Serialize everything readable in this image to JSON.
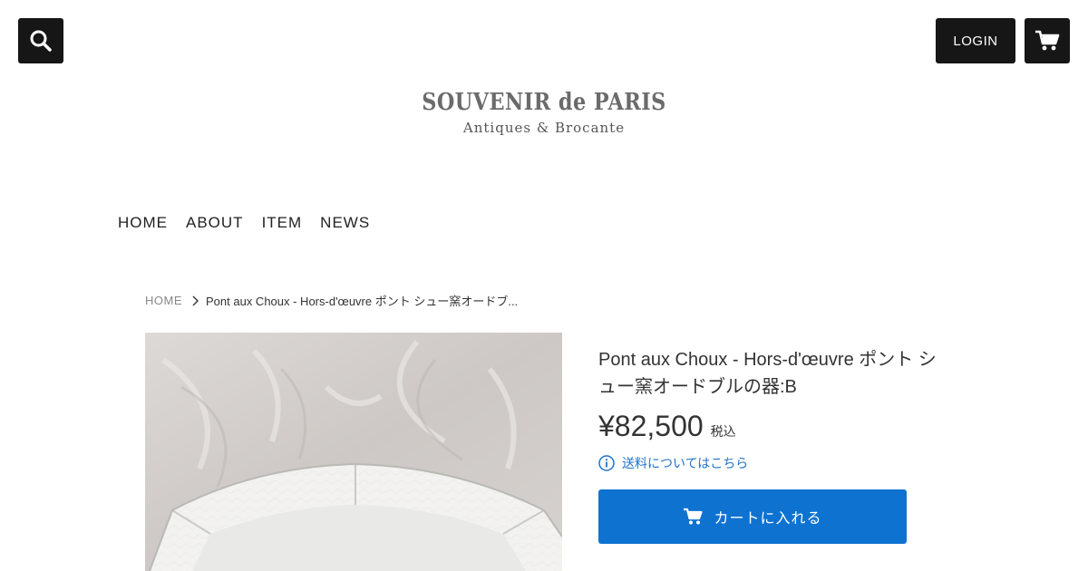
{
  "header": {
    "search_icon": "search-icon",
    "login_label": "LOGIN",
    "cart_icon": "cart-icon",
    "logo_title": "SOUVENIR de PARIS",
    "logo_subtitle": "Antiques & Brocante"
  },
  "nav": {
    "items": [
      {
        "label": "HOME"
      },
      {
        "label": "ABOUT"
      },
      {
        "label": "ITEM"
      },
      {
        "label": "NEWS"
      }
    ]
  },
  "breadcrumb": {
    "home": "HOME",
    "current": "Pont aux Choux - Hors-d'œuvre ポント シュー窯オードブ..."
  },
  "product": {
    "title": "Pont aux Choux - Hors-d'œuvre ポント シュー窯オードブルの器:B",
    "price": "¥82,500",
    "tax_label": "税込",
    "shipping_link": "送料についてはこちら",
    "add_to_cart": "カートに入れる"
  },
  "colors": {
    "dark_button": "#161616",
    "accent_blue": "#0e72d0",
    "link_blue": "#1f73c9"
  }
}
